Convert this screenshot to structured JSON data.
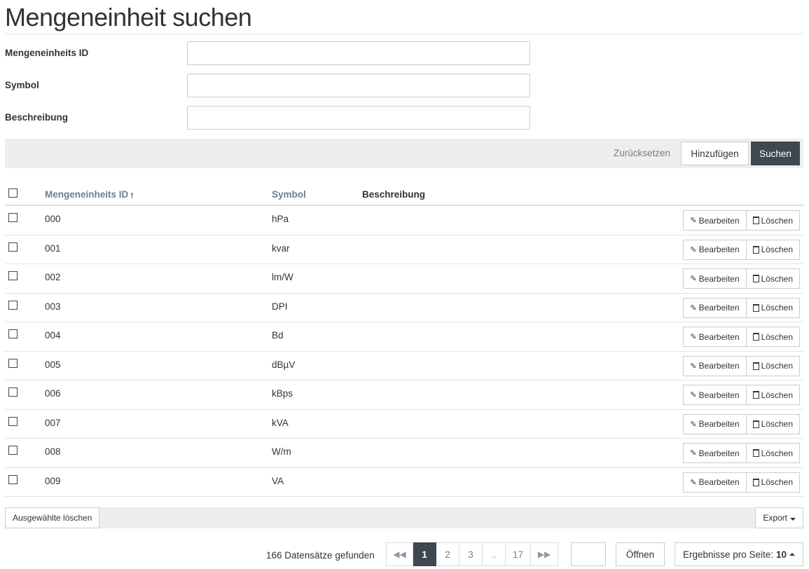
{
  "page": {
    "title": "Mengeneinheit suchen"
  },
  "form": {
    "fields": [
      {
        "label": "Mengeneinheits ID",
        "value": ""
      },
      {
        "label": "Symbol",
        "value": ""
      },
      {
        "label": "Beschreibung",
        "value": ""
      }
    ]
  },
  "actions": {
    "reset_label": "Zurücksetzen",
    "add_label": "Hinzufügen",
    "search_label": "Suchen"
  },
  "table": {
    "columns": {
      "id": "Mengeneinheits ID",
      "symbol": "Symbol",
      "description": "Beschreibung"
    },
    "edit_label": "Bearbeiten",
    "delete_label": "Löschen",
    "rows": [
      {
        "id": "000",
        "symbol": "hPa",
        "description": ""
      },
      {
        "id": "001",
        "symbol": "kvar",
        "description": ""
      },
      {
        "id": "002",
        "symbol": "lm/W",
        "description": ""
      },
      {
        "id": "003",
        "symbol": "DPI",
        "description": ""
      },
      {
        "id": "004",
        "symbol": "Bd",
        "description": ""
      },
      {
        "id": "005",
        "symbol": "dBµV",
        "description": ""
      },
      {
        "id": "006",
        "symbol": "kBps",
        "description": ""
      },
      {
        "id": "007",
        "symbol": "kVA",
        "description": ""
      },
      {
        "id": "008",
        "symbol": "W/m",
        "description": ""
      },
      {
        "id": "009",
        "symbol": "VA",
        "description": ""
      }
    ]
  },
  "bulk": {
    "delete_selected_label": "Ausgewählte löschen",
    "export_label": "Export"
  },
  "pager": {
    "records_found": "166 Datensätze gefunden",
    "pages": [
      "1",
      "2",
      "3",
      "..",
      "17"
    ],
    "current_page": "1",
    "page_input_value": "",
    "open_label": "Öffnen",
    "per_page_label": "Ergebnisse pro Seite:",
    "per_page_value": "10"
  },
  "icons": {
    "sort_ascending": "arrow-up-icon",
    "edit": "pencil-icon",
    "delete": "trash-icon",
    "first_page": "double-chevron-left-icon",
    "last_page": "double-chevron-right-icon"
  }
}
